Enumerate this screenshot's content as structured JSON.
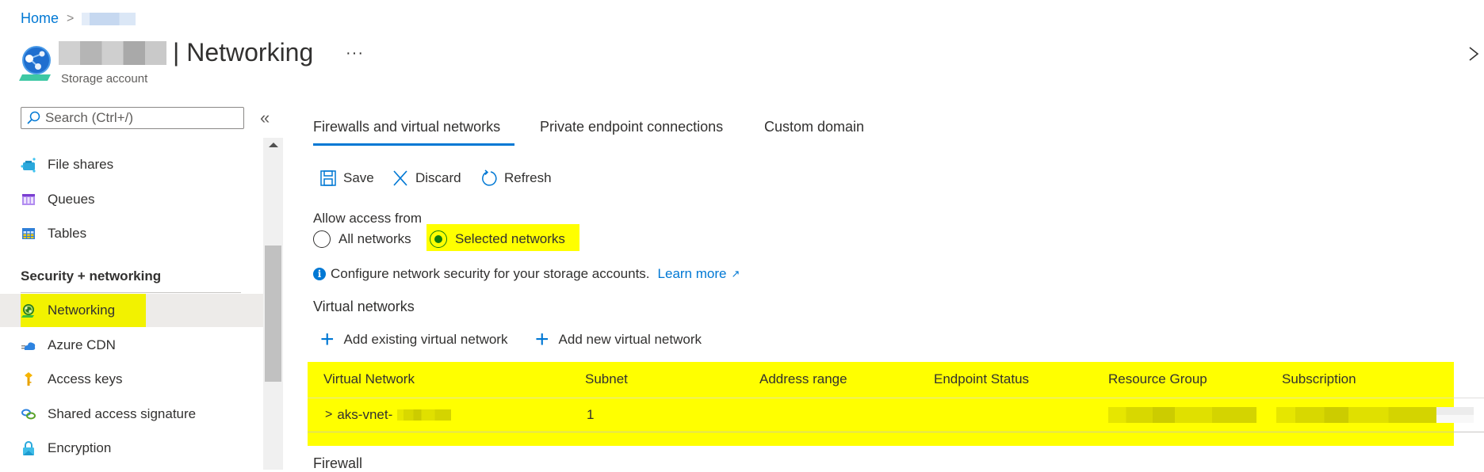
{
  "breadcrumb": {
    "home": "Home",
    "separator": ">"
  },
  "header": {
    "title_suffix": "| Networking",
    "subtitle": "Storage account",
    "more_label": "···",
    "close_label": "✕"
  },
  "sidebar": {
    "search_placeholder": "Search (Ctrl+/)",
    "collapse_label": "«",
    "items_top": [
      {
        "label": "File shares",
        "icon": "file-shares-icon"
      },
      {
        "label": "Queues",
        "icon": "queues-icon"
      },
      {
        "label": "Tables",
        "icon": "tables-icon"
      }
    ],
    "section_title": "Security + networking",
    "items_security": [
      {
        "label": "Networking",
        "icon": "networking-icon",
        "selected": true
      },
      {
        "label": "Azure CDN",
        "icon": "azure-cdn-icon"
      },
      {
        "label": "Access keys",
        "icon": "key-icon"
      },
      {
        "label": "Shared access signature",
        "icon": "link-icon"
      },
      {
        "label": "Encryption",
        "icon": "lock-icon"
      }
    ]
  },
  "tabs": [
    {
      "label": "Firewalls and virtual networks",
      "active": true
    },
    {
      "label": "Private endpoint connections",
      "active": false
    },
    {
      "label": "Custom domain",
      "active": false
    }
  ],
  "toolbar": {
    "save": "Save",
    "discard": "Discard",
    "refresh": "Refresh"
  },
  "access": {
    "label": "Allow access from",
    "options": [
      {
        "label": "All networks",
        "selected": false
      },
      {
        "label": "Selected networks",
        "selected": true
      }
    ]
  },
  "info": {
    "text": "Configure network security for your storage accounts.",
    "link": "Learn more"
  },
  "virtual_networks": {
    "heading": "Virtual networks",
    "add_existing": "Add existing virtual network",
    "add_new": "Add new virtual network",
    "columns": [
      "Virtual Network",
      "Subnet",
      "Address range",
      "Endpoint Status",
      "Resource Group",
      "Subscription"
    ],
    "rows": [
      {
        "virtual_network": "aks-vnet-",
        "subnet": "1",
        "address_range": "",
        "endpoint_status": "",
        "resource_group": "",
        "subscription": ""
      }
    ]
  },
  "firewall_heading": "Firewall",
  "colors": {
    "accent": "#0078d4",
    "highlight": "#ffff00",
    "selected_radio": "#107c10"
  }
}
